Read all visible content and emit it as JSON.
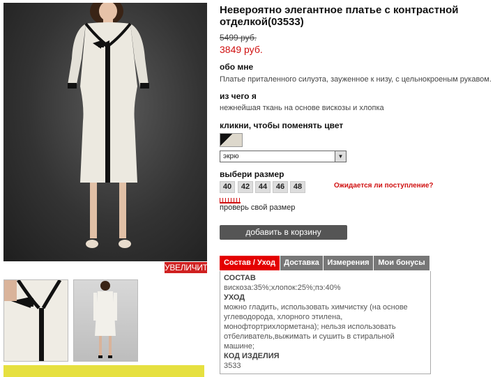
{
  "product": {
    "title": "Невероятно элегантное платье с контрастной отделкой(03533)",
    "old_price": "5499 руб.",
    "new_price": "3849 руб."
  },
  "gallery": {
    "zoom_label": "УВЕЛИЧИТЬ"
  },
  "about": {
    "heading": "обо мне",
    "text": "Платье приталенного силуэта, зауженное к низу, с цельнокроеным рукавом."
  },
  "material": {
    "heading": "из чего я",
    "text": "нежнейшая ткань на основе вискозы и хлопка"
  },
  "color": {
    "heading": "кликни, чтобы поменять цвет",
    "selected": "экрю"
  },
  "size": {
    "heading": "выбери размер",
    "options": [
      "40",
      "42",
      "44",
      "46",
      "48"
    ],
    "awaiting_link": "Ожидается ли поступление?",
    "check_size": "проверь свой размер"
  },
  "cart": {
    "button_label": "добавить в корзину"
  },
  "tabs": [
    "Состав / Уход",
    "Доставка",
    "Измерения",
    "Мои бонусы"
  ],
  "details": {
    "composition_h": "СОСТАВ",
    "composition": "вискоза:35%;хлопок:25%;пэ:40%",
    "care_h": "УХОД",
    "care": "можно гладить, использовать химчистку (на основе углеводорода, хлорного этилена, монофтортрихлорметана); нельзя использовать отбеливатель,выжимать и сушить в стиральной машине;",
    "code_h": "КОД ИЗДЕЛИЯ",
    "code": "3533"
  },
  "colors": {
    "accent": "#e40000",
    "price": "#d01010",
    "button": "#555555"
  }
}
